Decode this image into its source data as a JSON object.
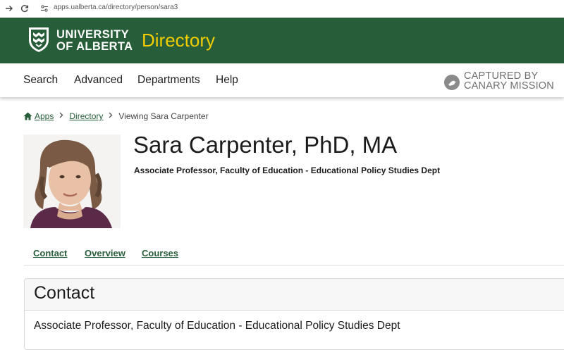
{
  "browser": {
    "url": "apps.ualberta.ca/directory/person/sara3",
    "icons": [
      "forward-arrow-icon",
      "reload-icon",
      "site-settings-icon"
    ]
  },
  "header": {
    "university_line1": "UNIVERSITY",
    "university_line2": "OF ALBERTA",
    "section_title": "Directory",
    "brand_color": "#275d38",
    "accent_color": "#f2cd00"
  },
  "nav": {
    "items": [
      "Search",
      "Advanced",
      "Departments",
      "Help"
    ]
  },
  "watermark": {
    "line1": "CAPTURED BY",
    "line2": "CANARY MISSION"
  },
  "breadcrumb": {
    "home": "Apps",
    "directory": "Directory",
    "current": "Viewing Sara Carpenter"
  },
  "profile": {
    "name": "Sara Carpenter, PhD, MA",
    "title": "Associate Professor, Faculty of Education - Educational Policy Studies Dept"
  },
  "tabs": [
    "Contact",
    "Overview",
    "Courses"
  ],
  "contact": {
    "heading": "Contact",
    "position": "Associate Professor, Faculty of Education - Educational Policy Studies Dept"
  }
}
